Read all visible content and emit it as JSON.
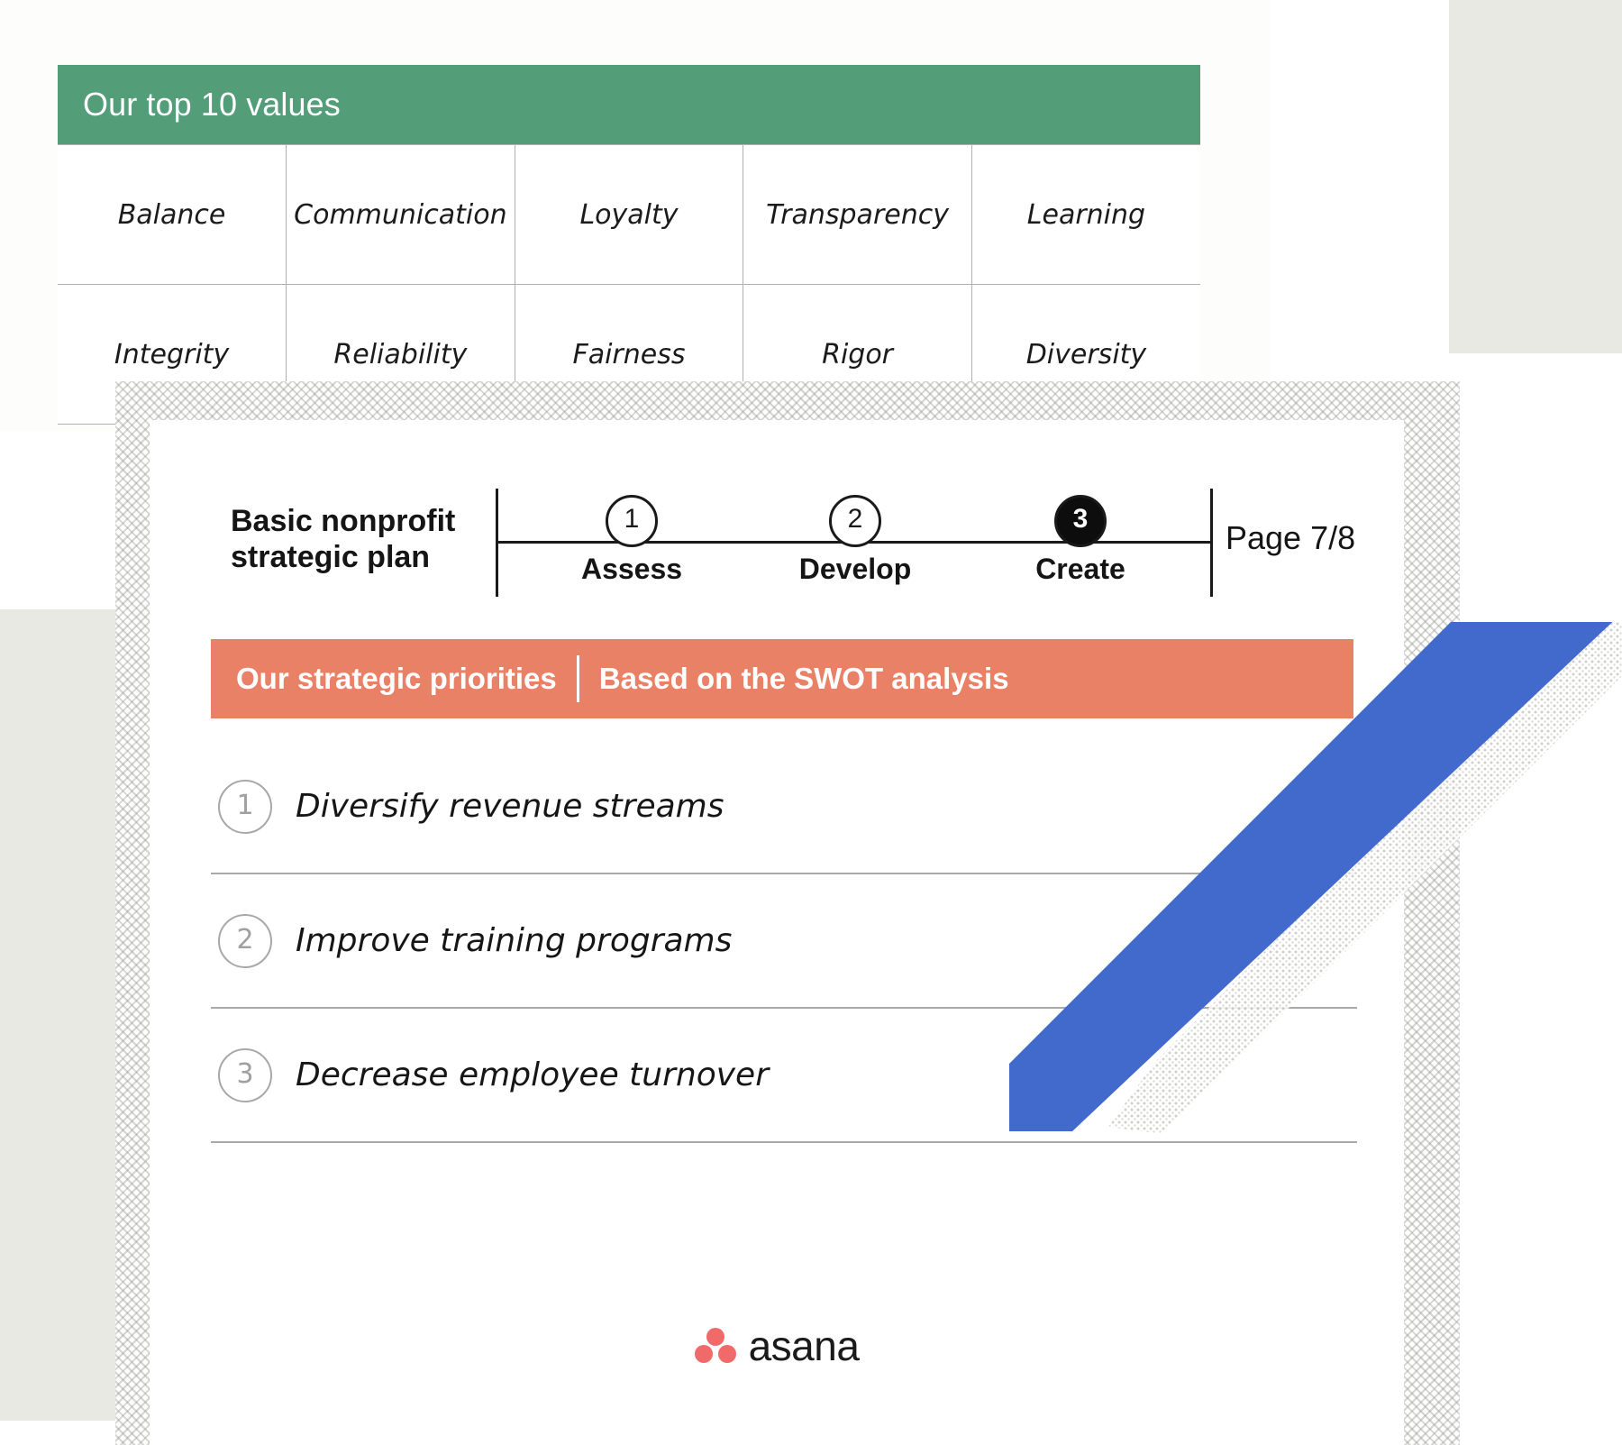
{
  "background": {
    "block_color": "#e9e9e4",
    "page_color": "#ffffff"
  },
  "values_card": {
    "header": {
      "title": "Our top 10 values",
      "background_color": "#539d79",
      "text_color": "#ffffff"
    },
    "table": {
      "rows": [
        [
          "Balance",
          "Communication",
          "Loyalty",
          "Transparency",
          "Learning"
        ],
        [
          "Integrity",
          "Reliability",
          "Fairness",
          "Rigor",
          "Diversity"
        ]
      ]
    }
  },
  "plan_card": {
    "title": "Basic nonprofit strategic plan",
    "title_line1": "Basic nonprofit",
    "title_line2": "strategic plan",
    "stepper": {
      "steps": [
        {
          "number": "1",
          "label": "Assess",
          "active": false
        },
        {
          "number": "2",
          "label": "Develop",
          "active": false
        },
        {
          "number": "3",
          "label": "Create",
          "active": true
        }
      ],
      "active_color": "#0d0d0d"
    },
    "page_count": "Page 7/8",
    "banner": {
      "left_label": "Our strategic priorities",
      "right_label": "Based on the SWOT analysis",
      "background_color": "#e98166",
      "text_color": "#ffffff"
    },
    "priorities": [
      {
        "number": "1",
        "text": "Diversify revenue streams"
      },
      {
        "number": "2",
        "text": "Improve training programs"
      },
      {
        "number": "3",
        "text": "Decrease employee turnover"
      }
    ],
    "footer": {
      "brand": "asana",
      "brand_color": "#f06a6a"
    }
  },
  "decoration": {
    "pencil_color": "#4269cc",
    "pencil_icon": "pencil-icon"
  }
}
